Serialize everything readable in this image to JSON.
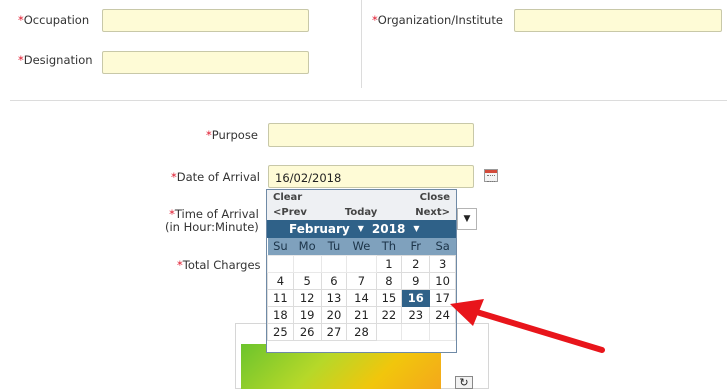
{
  "form": {
    "occupation": {
      "label": "Occupation",
      "value": ""
    },
    "organization": {
      "label": "Organization/Institute",
      "value": ""
    },
    "designation": {
      "label": "Designation",
      "value": ""
    },
    "purpose": {
      "label": "Purpose",
      "value": ""
    },
    "date_of_arrival": {
      "label": "Date of Arrival",
      "value": "16/02/2018"
    },
    "time_of_arrival": {
      "label_line1": "Time of Arrival",
      "label_line2": "(in Hour:Minute)"
    },
    "total_charges": {
      "label": "Total Charges"
    },
    "required_mark": "*",
    "dropdown_caret": "▼"
  },
  "calendar": {
    "clear": "Clear",
    "close": "Close",
    "prev": "<Prev",
    "today": "Today",
    "next": "Next>",
    "month": "February",
    "year": "2018",
    "caret": "▼",
    "weekdays": [
      "Su",
      "Mo",
      "Tu",
      "We",
      "Th",
      "Fr",
      "Sa"
    ],
    "weeks": [
      [
        "",
        "",
        "",
        "",
        "1",
        "2",
        "3"
      ],
      [
        "4",
        "5",
        "6",
        "7",
        "8",
        "9",
        "10"
      ],
      [
        "11",
        "12",
        "13",
        "14",
        "15",
        "16",
        "17"
      ],
      [
        "18",
        "19",
        "20",
        "21",
        "22",
        "23",
        "24"
      ],
      [
        "25",
        "26",
        "27",
        "28",
        "",
        "",
        ""
      ]
    ],
    "selected_day": "16"
  },
  "captcha": {
    "refresh_icon": "refresh-icon",
    "refresh_glyph": "↻"
  },
  "colors": {
    "required": "#e0162b",
    "field_bg": "#fefbd6",
    "calendar_header": "#2f6188",
    "calendar_weekday_bg": "#7fa1bd",
    "annotation_arrow": "#e8151b"
  }
}
